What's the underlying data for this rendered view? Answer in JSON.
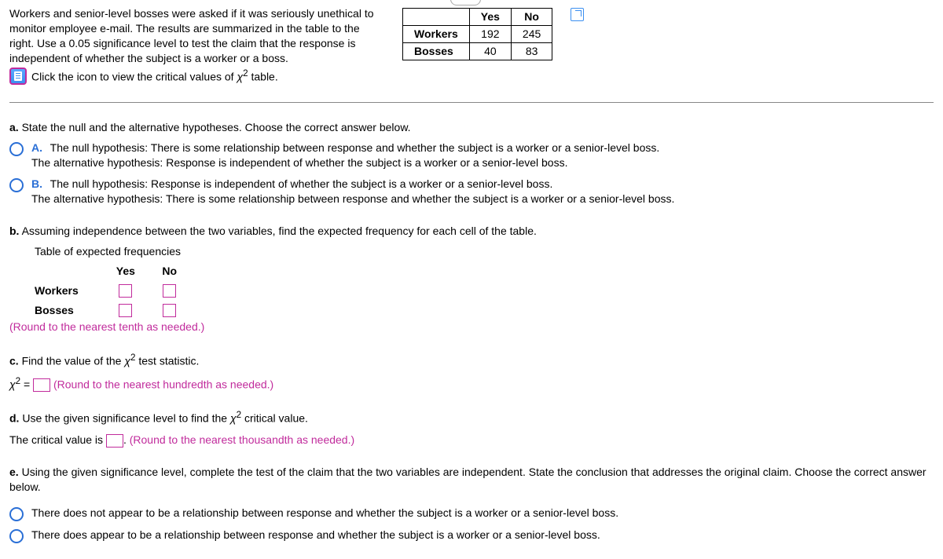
{
  "problem": {
    "intro": "Workers and senior-level bosses were asked if it was seriously unethical to monitor employee e-mail. The results are summarized in the table to the right. Use a 0.05 significance level to test the claim that the response is independent of whether the subject is a worker or a boss.",
    "link_text": "Click the icon to view the critical values of ",
    "link_tail": " table."
  },
  "table": {
    "col1": "Yes",
    "col2": "No",
    "row1_label": "Workers",
    "row2_label": "Bosses",
    "r1c1": "192",
    "r1c2": "245",
    "r2c1": "40",
    "r2c2": "83"
  },
  "a": {
    "prompt_prefix": "a.",
    "prompt": " State the null and the alternative hypotheses. Choose the correct answer below.",
    "optA_label": "A.",
    "optA_l1": "The null hypothesis: There is some relationship between response and whether the subject is a worker or a senior-level boss.",
    "optA_l2": "The alternative hypothesis: Response is independent of whether the subject is a worker or a senior-level boss.",
    "optB_label": "B.",
    "optB_l1": "The null hypothesis: Response is independent of whether the subject is a worker or a senior-level boss.",
    "optB_l2": "The alternative hypothesis: There is some relationship between response and whether the subject is a worker or a senior-level boss."
  },
  "b": {
    "prompt_prefix": "b.",
    "prompt": " Assuming independence between the two variables, find the expected frequency for each cell of the table.",
    "caption": "Table of expected frequencies",
    "col1": "Yes",
    "col2": "No",
    "row1": "Workers",
    "row2": "Bosses",
    "round": "(Round to the nearest tenth as needed.)"
  },
  "c": {
    "prompt_prefix": "c.",
    "prompt_pre": " Find the value of the ",
    "prompt_post": "  test statistic.",
    "eq_pre": " = ",
    "round": "(Round to the nearest hundredth as needed.)"
  },
  "d": {
    "prompt_prefix": "d.",
    "prompt_pre": " Use the given significance level to find the ",
    "prompt_post": " critical value.",
    "line_pre": "The critical value is ",
    "line_post": ". ",
    "round": "(Round to the nearest thousandth as needed.)"
  },
  "e": {
    "prompt_prefix": "e.",
    "prompt": " Using the given significance level, complete the test of the claim that the two variables are independent. State the conclusion that addresses the original claim. Choose the correct answer below.",
    "opt1": "There does not appear to be a relationship between response and whether the subject is a worker or a senior-level boss.",
    "opt2": "There does appear to be a relationship between response and whether the subject is a worker or a senior-level boss."
  },
  "chart_data": {
    "type": "table",
    "title": "Observed frequencies",
    "categories": [
      "Yes",
      "No"
    ],
    "series": [
      {
        "name": "Workers",
        "values": [
          192,
          245
        ]
      },
      {
        "name": "Bosses",
        "values": [
          40,
          83
        ]
      }
    ]
  }
}
